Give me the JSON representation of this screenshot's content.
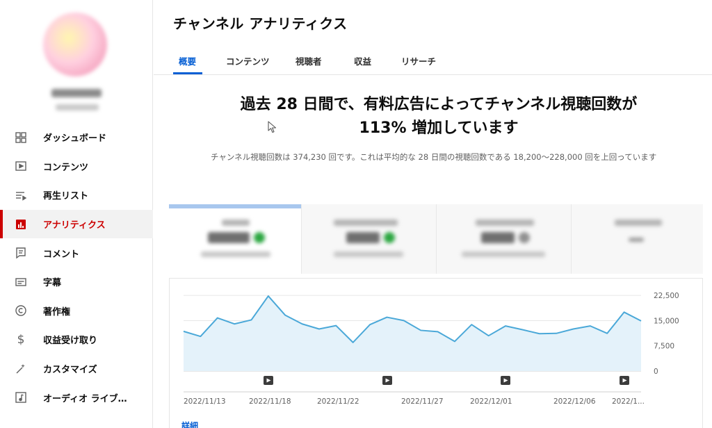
{
  "sidebar": {
    "items": [
      {
        "label": "ダッシュボード",
        "icon": "dashboard-icon"
      },
      {
        "label": "コンテンツ",
        "icon": "content-icon"
      },
      {
        "label": "再生リスト",
        "icon": "playlist-icon"
      },
      {
        "label": "アナリティクス",
        "icon": "analytics-icon",
        "active": true
      },
      {
        "label": "コメント",
        "icon": "comment-icon"
      },
      {
        "label": "字幕",
        "icon": "subtitles-icon"
      },
      {
        "label": "著作権",
        "icon": "copyright-icon"
      },
      {
        "label": "収益受け取り",
        "icon": "dollar-icon"
      },
      {
        "label": "カスタマイズ",
        "icon": "magic-wand-icon"
      },
      {
        "label": "オーディオ ライブ…",
        "icon": "audio-library-icon"
      }
    ]
  },
  "header": {
    "title": "チャンネル アナリティクス"
  },
  "tabs": [
    {
      "label": "概要",
      "active": true
    },
    {
      "label": "コンテンツ"
    },
    {
      "label": "視聴者"
    },
    {
      "label": "収益"
    },
    {
      "label": "リサーチ"
    }
  ],
  "summary": {
    "headline_line1": "過去 28 日間で、有料広告によってチャンネル視聴回数が",
    "headline_line2": "113% 増加しています",
    "description": "チャンネル視聴回数は 374,230 回です。これは平均的な 28 日間の視聴回数である 18,200～228,000 回を上回っています"
  },
  "colors": {
    "accent": "#065fd4",
    "active_red": "#cc0000",
    "chart_line": "#4aa8d8",
    "chart_fill": "#e4f2fa",
    "metric_up": "#2ba640"
  },
  "chart_data": {
    "type": "area",
    "x_tick_labels": [
      "2022/11/13",
      "2022/11/18",
      "2022/11/22",
      "2022/11/27",
      "2022/12/01",
      "2022/12/06",
      "2022/1..."
    ],
    "y_tick_labels": [
      "22,500",
      "15,000",
      "7,500",
      "0"
    ],
    "ylim": [
      0,
      25000
    ],
    "values": [
      11800,
      10300,
      15800,
      14000,
      15200,
      22300,
      16600,
      14000,
      12500,
      13500,
      8500,
      13800,
      16000,
      15000,
      12100,
      11700,
      8800,
      13800,
      10500,
      13400,
      12300,
      11100,
      11200,
      12500,
      13400,
      11200,
      17500,
      14900
    ],
    "grid": true
  },
  "footer": {
    "detail_link": "詳細"
  }
}
